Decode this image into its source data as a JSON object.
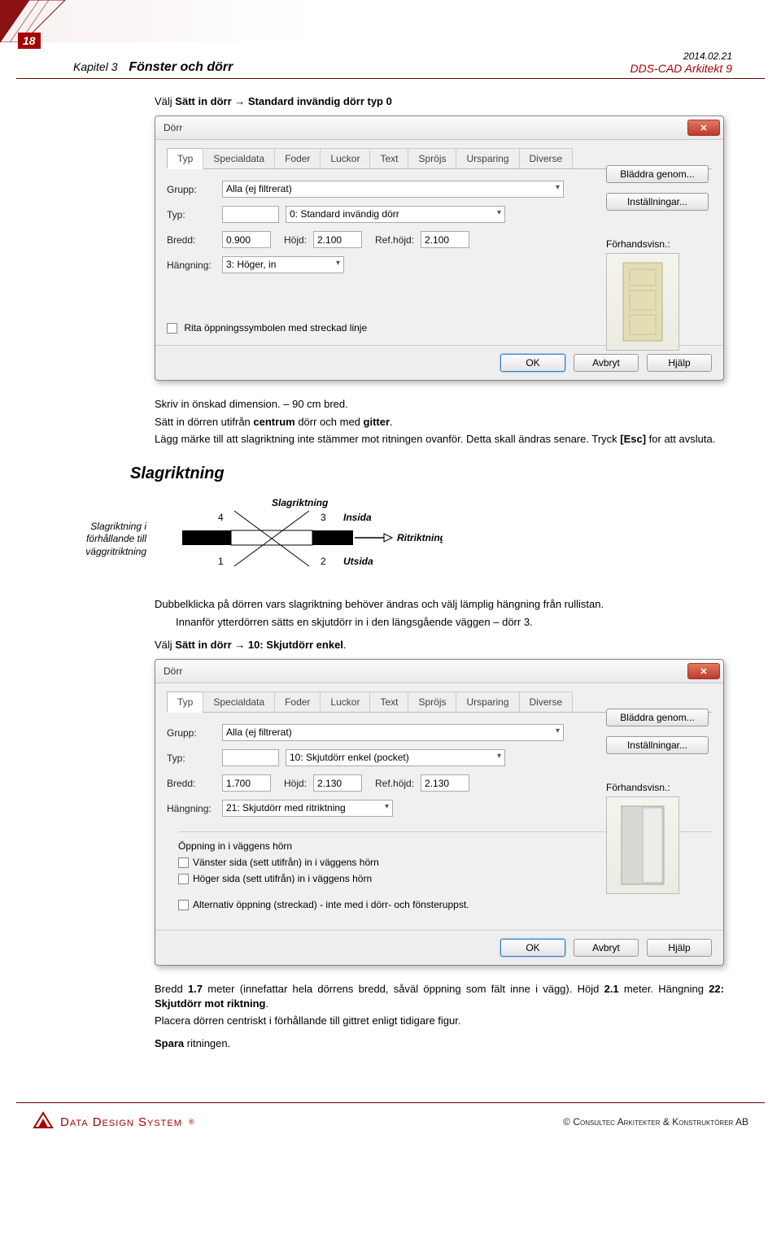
{
  "header": {
    "page_number": "18",
    "chapter": "Kapitel 3",
    "title": "Fönster och dörr",
    "date": "2014.02.21",
    "product": "DDS-CAD Arkitekt 9"
  },
  "choose1": {
    "prefix": "Välj ",
    "bold1": "Sätt in dörr",
    "arrow": " → ",
    "bold2": "Standard invändig dörr typ 0"
  },
  "dialog1": {
    "title": "Dörr",
    "tabs": [
      "Typ",
      "Specialdata",
      "Foder",
      "Luckor",
      "Text",
      "Spröjs",
      "Ursparing",
      "Diverse"
    ],
    "active_tab": 0,
    "labels": {
      "grupp": "Grupp:",
      "typ": "Typ:",
      "bredd": "Bredd:",
      "hojd": "Höjd:",
      "refhojd": "Ref.höjd:",
      "hangning": "Hängning:",
      "forhand": "Förhandsvisn.:"
    },
    "values": {
      "grupp": "Alla (ej filtrerat)",
      "typ_code": "",
      "typ_name": "0:  Standard invändig dörr",
      "bredd": "0.900",
      "hojd": "2.100",
      "refhojd": "2.100",
      "hangning": "3: Höger, in"
    },
    "checkboxes": {
      "streckad": "Rita öppningssymbolen med streckad linje"
    },
    "buttons": {
      "bladdra": "Bläddra genom...",
      "install": "Inställningar...",
      "ok": "OK",
      "avbryt": "Avbryt",
      "hjalp": "Hjälp"
    }
  },
  "para1": {
    "l1a": "Skriv in önskad dimension. – 90 cm bred.",
    "l2a": "Sätt in dörren utifrån ",
    "l2b": "centrum",
    "l2c": " dörr och med ",
    "l2d": "gitter",
    "l2e": ".",
    "l3": "Lägg märke till att slagriktning inte stämmer mot ritningen ovanför. Detta skall ändras senare. Tryck ",
    "l3b": "[Esc]",
    "l3c": " for att avsluta."
  },
  "section_heading": "Slagriktning",
  "diagram": {
    "side_note": "Slagriktning i förhållande till väggritriktning",
    "title": "Slagriktning",
    "n1": "1",
    "n2": "2",
    "n3": "3",
    "n4": "4",
    "insida": "Insida",
    "utsida": "Utsida",
    "ritrikt": "Ritriktning"
  },
  "para2": {
    "l1": "Dubbelklicka på dörren vars slagriktning behöver ändras och välj lämplig hängning från rullistan.",
    "l2": "Innanför ytterdörren sätts en skjutdörr in i den längsgående väggen – dörr 3."
  },
  "choose2": {
    "prefix": "Välj ",
    "bold1": "Sätt in dörr",
    "arrow": " → ",
    "bold2": "10: Skjutdörr enkel",
    "suffix": "."
  },
  "dialog2": {
    "title": "Dörr",
    "tabs": [
      "Typ",
      "Specialdata",
      "Foder",
      "Luckor",
      "Text",
      "Spröjs",
      "Ursparing",
      "Diverse"
    ],
    "active_tab": 0,
    "labels": {
      "grupp": "Grupp:",
      "typ": "Typ:",
      "bredd": "Bredd:",
      "hojd": "Höjd:",
      "refhojd": "Ref.höjd:",
      "hangning": "Hängning:",
      "forhand": "Förhandsvisn.:",
      "opening_head": "Öppning in i väggens hörn"
    },
    "values": {
      "grupp": "Alla (ej filtrerat)",
      "typ_code": "",
      "typ_name": "10:  Skjutdörr enkel (pocket)",
      "bredd": "1.700",
      "hojd": "2.130",
      "refhojd": "2.130",
      "hangning": "21: Skjutdörr med ritriktning"
    },
    "checkboxes": {
      "v": "Vänster sida (sett utifrån) in i väggens hörn",
      "h": "Höger sida (sett utifrån) in i väggens hörn",
      "alt": "Alternativ öppning (streckad) - inte med i dörr- och fönsteruppst."
    },
    "buttons": {
      "bladdra": "Bläddra genom...",
      "install": "Inställningar...",
      "ok": "OK",
      "avbryt": "Avbryt",
      "hjalp": "Hjälp"
    }
  },
  "para3": {
    "l1a": "Bredd ",
    "l1b": "1.7",
    "l1c": " meter (innefattar hela dörrens bredd, såväl öppning som fält inne i vägg). Höjd ",
    "l1d": "2.1",
    "l1e": " meter. Hängning ",
    "l1f": "22: Skjutdörr mot riktning",
    "l1g": ".",
    "l2": "Placera dörren centriskt i förhållande till gittret enligt tidigare figur.",
    "l3a": "Spara",
    "l3b": " ritningen."
  },
  "footer": {
    "logo_label": "Data Design System",
    "right": "© Consultec Arkitekter & Konstruktörer AB"
  }
}
